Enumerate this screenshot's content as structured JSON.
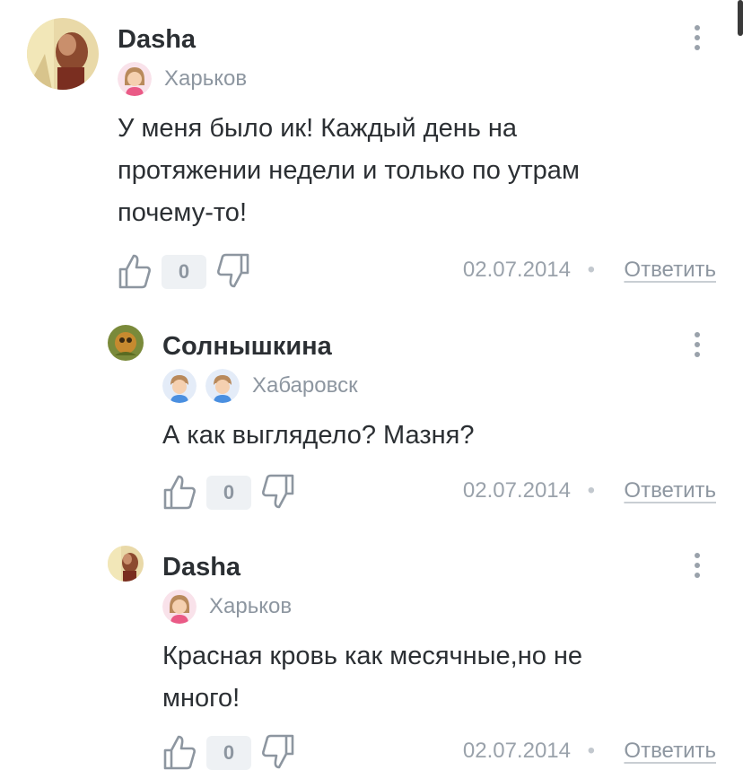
{
  "comments": [
    {
      "author": "Dasha",
      "city": "Харьков",
      "text_lines": [
        "У меня было ик! Каждый день на",
        "протяжении недели и только по утрам",
        "почему-то!"
      ],
      "likes": "0",
      "date": "02.07.2014",
      "separator": "•",
      "reply": "Ответить",
      "avatar": "photo-avatar",
      "badges": [
        "girl-icon"
      ]
    },
    {
      "author": "Солнышкина",
      "city": "Хабаровск",
      "text_lines": [
        "А как выглядело? Мазня?"
      ],
      "likes": "0",
      "date": "02.07.2014",
      "separator": "•",
      "reply": "Ответить",
      "avatar": "photo-avatar",
      "badges": [
        "boy-icon",
        "boy-icon"
      ]
    },
    {
      "author": "Dasha",
      "city": "Харьков",
      "text_lines": [
        "Красная кровь как месячные,но не",
        "много!"
      ],
      "likes": "0",
      "date": "02.07.2014",
      "separator": "•",
      "reply": "Ответить",
      "avatar": "photo-avatar",
      "badges": [
        "girl-icon"
      ]
    }
  ],
  "colors": {
    "text": "#2b2f33",
    "muted": "#8d96a0",
    "count_bg": "#eef1f4",
    "girl_badge": "#f9e2ea",
    "boy_badge": "#e4ecf8"
  }
}
